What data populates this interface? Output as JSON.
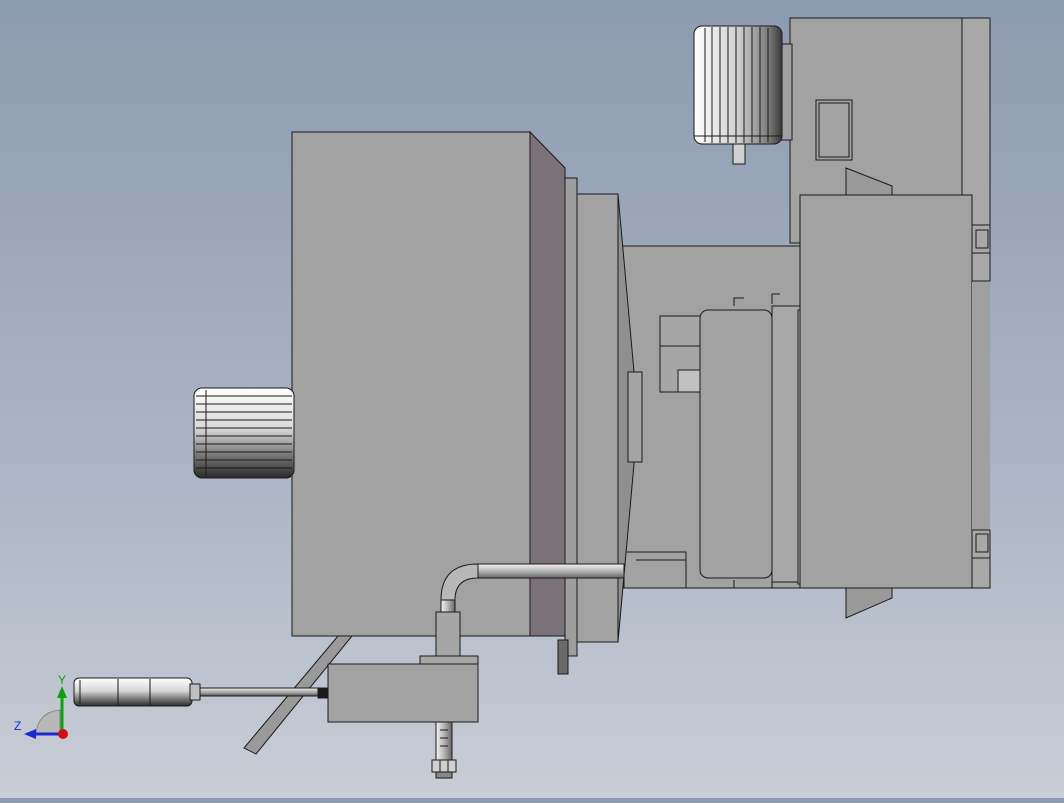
{
  "viewport": {
    "background_top": "#8d9bb0",
    "background_bottom": "#c9cdd6",
    "part_color": "#a2a2a2",
    "part_shadow_color": "#7b7178",
    "edge_color": "#1a1a1a"
  },
  "triad": {
    "x_label": "",
    "y_label": "Y",
    "z_label": "Z",
    "x_color": "#d01010",
    "y_color": "#10a010",
    "z_color": "#1a2ad0"
  }
}
